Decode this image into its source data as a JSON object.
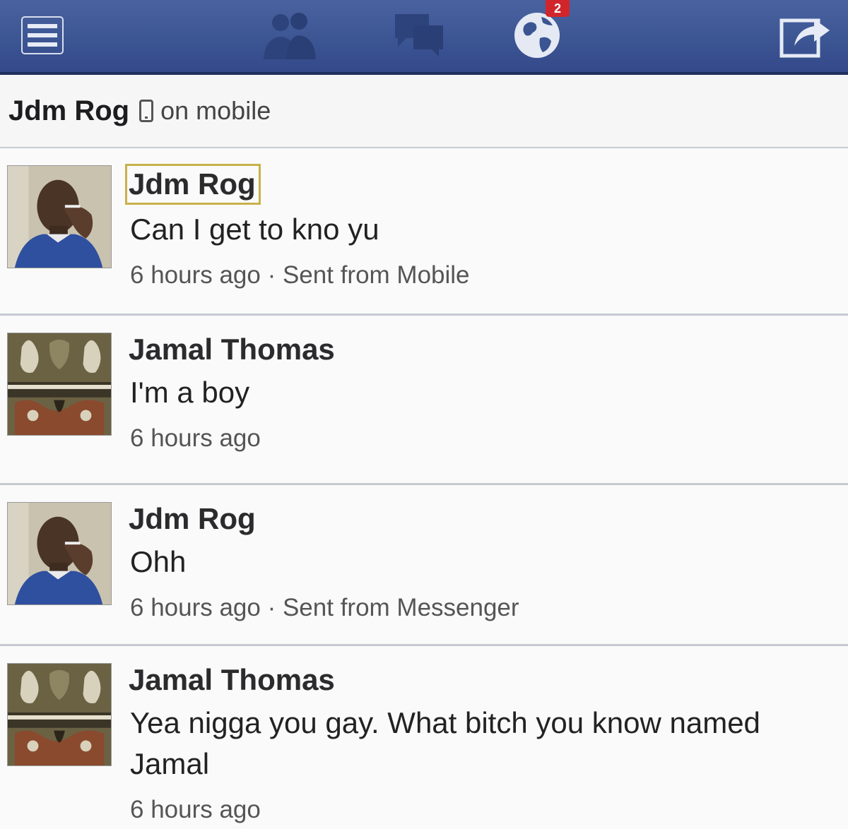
{
  "nav": {
    "menu_icon": "menu-icon",
    "friends_icon": "friend-requests-icon",
    "messages_icon": "messages-icon",
    "notifications_icon": "globe-icon",
    "notifications_badge": "2",
    "share_icon": "share-icon"
  },
  "header": {
    "name": "Jdm Rog",
    "status": "on mobile"
  },
  "messages": [
    {
      "sender": "Jdm Rog",
      "text": "Can I get to kno yu",
      "meta": "6 hours ago · Sent from Mobile"
    },
    {
      "sender": "Jamal Thomas",
      "text": "I'm a boy",
      "meta": "6 hours ago"
    },
    {
      "sender": "Jdm Rog",
      "text": "Ohh",
      "meta": "6 hours ago · Sent from Messenger"
    },
    {
      "sender": "Jamal Thomas",
      "text": "Yea nigga you gay. What bitch you know named Jamal",
      "meta": "6 hours ago"
    }
  ],
  "colors": {
    "nav_bar": "#3b5492",
    "badge": "#d0262b",
    "sender_highlight": "#c8b24a"
  }
}
